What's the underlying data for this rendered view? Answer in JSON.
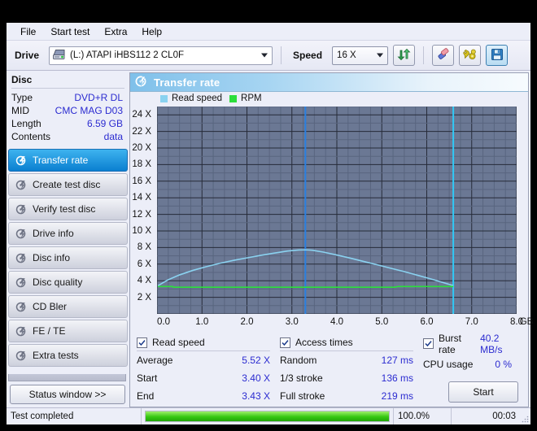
{
  "menu": {
    "items": [
      {
        "label": "File"
      },
      {
        "label": "Start test"
      },
      {
        "label": "Extra"
      },
      {
        "label": "Help"
      }
    ]
  },
  "toolbar": {
    "drive_label": "Drive",
    "drive_value": "(L:)  ATAPI iHBS112  2 CL0F",
    "speed_label": "Speed",
    "speed_value": "16 X",
    "refresh_icon": "refresh-icon",
    "eraser_icon": "eraser-icon",
    "tools_icon": "tools-icon",
    "save_icon": "save-floppy-icon"
  },
  "disc": {
    "heading": "Disc",
    "rows": [
      {
        "key": "Type",
        "value": "DVD+R DL"
      },
      {
        "key": "MID",
        "value": "CMC MAG D03"
      },
      {
        "key": "Length",
        "value": "6.59 GB"
      },
      {
        "key": "Contents",
        "value": "data"
      }
    ]
  },
  "sidebar": {
    "items": [
      {
        "label": "Transfer rate",
        "active": true
      },
      {
        "label": "Create test disc",
        "active": false
      },
      {
        "label": "Verify test disc",
        "active": false
      },
      {
        "label": "Drive info",
        "active": false
      },
      {
        "label": "Disc info",
        "active": false
      },
      {
        "label": "Disc quality",
        "active": false
      },
      {
        "label": "CD Bler",
        "active": false
      },
      {
        "label": "FE / TE",
        "active": false
      },
      {
        "label": "Extra tests",
        "active": false
      }
    ],
    "status_button": "Status window >>"
  },
  "panel": {
    "title": "Transfer rate",
    "icon": "disc-burn-icon"
  },
  "results": {
    "read_speed": {
      "checked": true,
      "title": "Read speed",
      "rows": [
        {
          "key": "Average",
          "value": "5.52 X"
        },
        {
          "key": "Start",
          "value": "3.40 X"
        },
        {
          "key": "End",
          "value": "3.43 X"
        }
      ]
    },
    "access_times": {
      "checked": true,
      "title": "Access times",
      "rows": [
        {
          "key": "Random",
          "value": "127 ms"
        },
        {
          "key": "1/3 stroke",
          "value": "136 ms"
        },
        {
          "key": "Full stroke",
          "value": "219 ms"
        }
      ]
    },
    "burst": {
      "checked": true,
      "title": "Burst rate",
      "value": "40.2 MB/s",
      "cpu_key": "CPU usage",
      "cpu_value": "0 %"
    },
    "start_button": "Start"
  },
  "statusbar": {
    "message": "Test completed",
    "percent_label": "100.0%",
    "percent": 100,
    "time": "00:03"
  },
  "colors": {
    "read_speed": "#8ad2f0",
    "rpm": "#2bde3b",
    "plot_bg": "#6b7894",
    "marker_blue": "#2a7fe0",
    "marker_cyan": "#31c8f5",
    "value_text": "#2b2bd0",
    "accent": "#0a7fd0",
    "progress": "#35c712"
  },
  "chart_data": {
    "type": "line",
    "title": "Transfer rate",
    "xlabel": "GB",
    "ylabel": "X",
    "xlim": [
      0.0,
      8.0
    ],
    "ylim": [
      0.0,
      25.0
    ],
    "grid": true,
    "legend_position": "top-left",
    "xticks": [
      "0.0",
      "1.0",
      "2.0",
      "3.0",
      "4.0",
      "5.0",
      "6.0",
      "7.0",
      "8.0"
    ],
    "xtick_values": [
      0,
      1,
      2,
      3,
      4,
      5,
      6,
      7,
      8
    ],
    "yticks": [
      "2 X",
      "4 X",
      "6 X",
      "8 X",
      "10 X",
      "12 X",
      "14 X",
      "16 X",
      "18 X",
      "20 X",
      "22 X",
      "24 X"
    ],
    "ytick_values": [
      2,
      4,
      6,
      8,
      10,
      12,
      14,
      16,
      18,
      20,
      22,
      24
    ],
    "x_axis_unit": "GB",
    "legend": [
      {
        "name": "Read speed",
        "color": "#8ad2f0"
      },
      {
        "name": "RPM",
        "color": "#2bde3b"
      }
    ],
    "series": [
      {
        "name": "Read speed",
        "color": "#8ad2f0",
        "x": [
          0.02,
          0.25,
          0.5,
          0.8,
          1.1,
          1.4,
          1.7,
          2.0,
          2.3,
          2.6,
          2.9,
          3.15,
          3.3,
          3.45,
          3.7,
          4.0,
          4.3,
          4.6,
          4.9,
          5.2,
          5.5,
          5.8,
          6.1,
          6.35,
          6.55,
          6.59
        ],
        "y": [
          3.4,
          4.12,
          4.7,
          5.25,
          5.7,
          6.1,
          6.45,
          6.75,
          7.05,
          7.32,
          7.58,
          7.7,
          7.72,
          7.68,
          7.45,
          7.1,
          6.72,
          6.32,
          5.92,
          5.5,
          5.1,
          4.65,
          4.2,
          3.8,
          3.48,
          3.43
        ]
      },
      {
        "name": "RPM",
        "color": "#2bde3b",
        "x": [
          0.02,
          0.35,
          0.36,
          5.3,
          5.35,
          6.59
        ],
        "y": [
          3.3,
          3.3,
          3.22,
          3.22,
          3.3,
          3.3
        ]
      }
    ],
    "markers": [
      {
        "name": "position-marker",
        "x": 3.3,
        "color": "#2a7fe0"
      },
      {
        "name": "disc-end-marker",
        "x": 6.59,
        "color": "#31c8f5"
      }
    ]
  }
}
